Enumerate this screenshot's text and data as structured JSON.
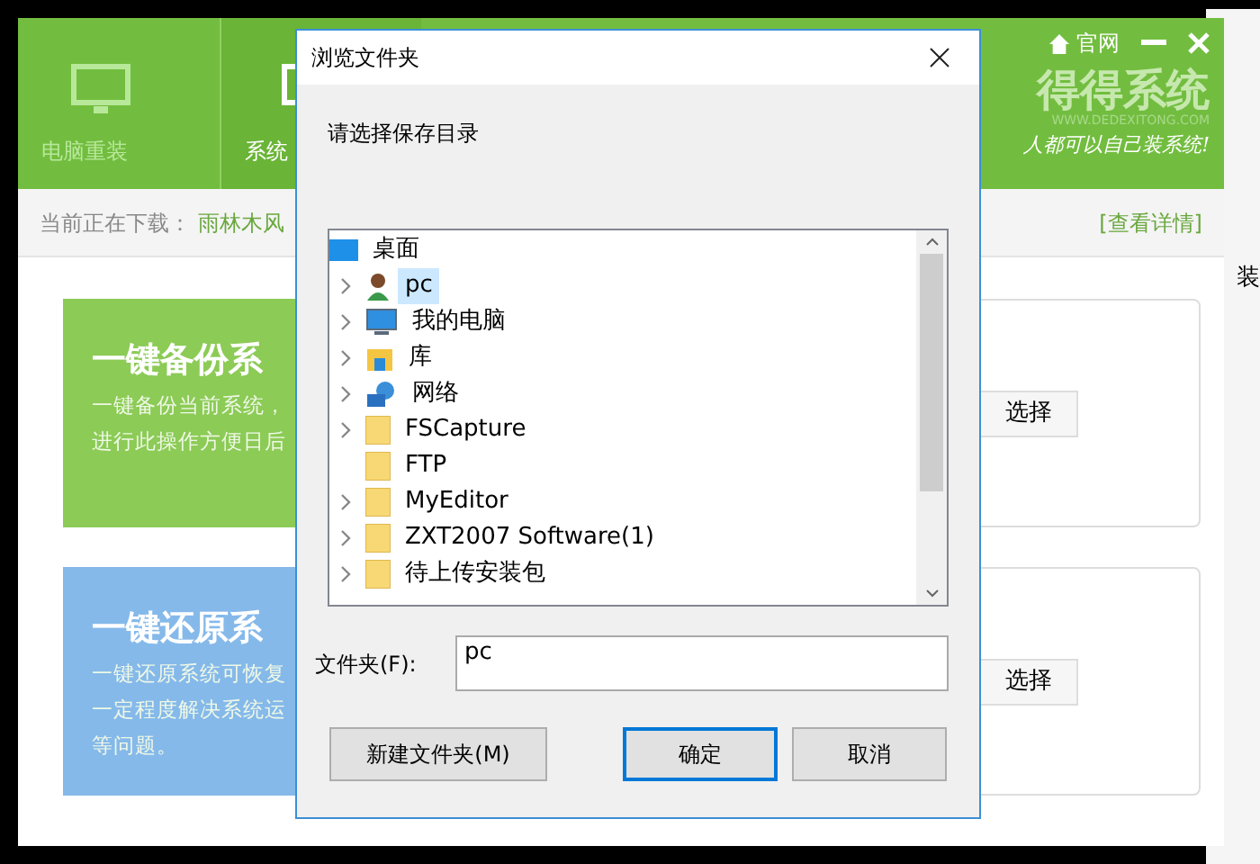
{
  "app": {
    "nav_tabs": [
      {
        "label": "电脑重装",
        "selected": false
      },
      {
        "label": "系统",
        "selected": true
      }
    ],
    "header_links": {
      "website": "官网"
    },
    "logo": {
      "name": "得得系统",
      "url": "WWW.DEDEXITONG.COM",
      "slogan": "人都可以自己装系统!"
    },
    "download_bar": {
      "label": "当前正在下载：",
      "value": "雨林木风",
      "link": "[查看详情]"
    },
    "cards": [
      {
        "kind": "backup",
        "title": "一键备份系",
        "lines": [
          "一键备份当前系统，",
          "进行此操作方便日后"
        ],
        "button": "选择"
      },
      {
        "kind": "restore",
        "title": "一键还原系",
        "lines": [
          "一键还原系统可恢复",
          "一定程度解决系统运",
          "等问题。"
        ],
        "button": "选择"
      }
    ]
  },
  "background_window": {
    "text": "装"
  },
  "dialog": {
    "title": "浏览文件夹",
    "prompt": "请选择保存目录",
    "tree": {
      "label": "桌面",
      "kind": "desktop",
      "selected": false,
      "children": [
        {
          "label": "pc",
          "kind": "user",
          "expandable": true,
          "selected": true
        },
        {
          "label": "我的电脑",
          "kind": "computer",
          "expandable": true,
          "selected": false
        },
        {
          "label": "库",
          "kind": "library",
          "expandable": true,
          "selected": false
        },
        {
          "label": "网络",
          "kind": "network",
          "expandable": true,
          "selected": false
        },
        {
          "label": "FSCapture",
          "kind": "folder",
          "expandable": true,
          "selected": false
        },
        {
          "label": "FTP",
          "kind": "folder",
          "expandable": false,
          "selected": false
        },
        {
          "label": "MyEditor",
          "kind": "folder",
          "expandable": true,
          "selected": false
        },
        {
          "label": "ZXT2007 Software(1)",
          "kind": "folder",
          "expandable": true,
          "selected": false
        },
        {
          "label": "待上传安装包",
          "kind": "folder",
          "expandable": true,
          "selected": false
        }
      ]
    },
    "folder_field": {
      "label": "文件夹(F):",
      "value": "pc"
    },
    "buttons": [
      {
        "label": "新建文件夹(M)",
        "default": false
      },
      {
        "label": "确定",
        "default": true
      },
      {
        "label": "取消",
        "default": false
      }
    ]
  }
}
